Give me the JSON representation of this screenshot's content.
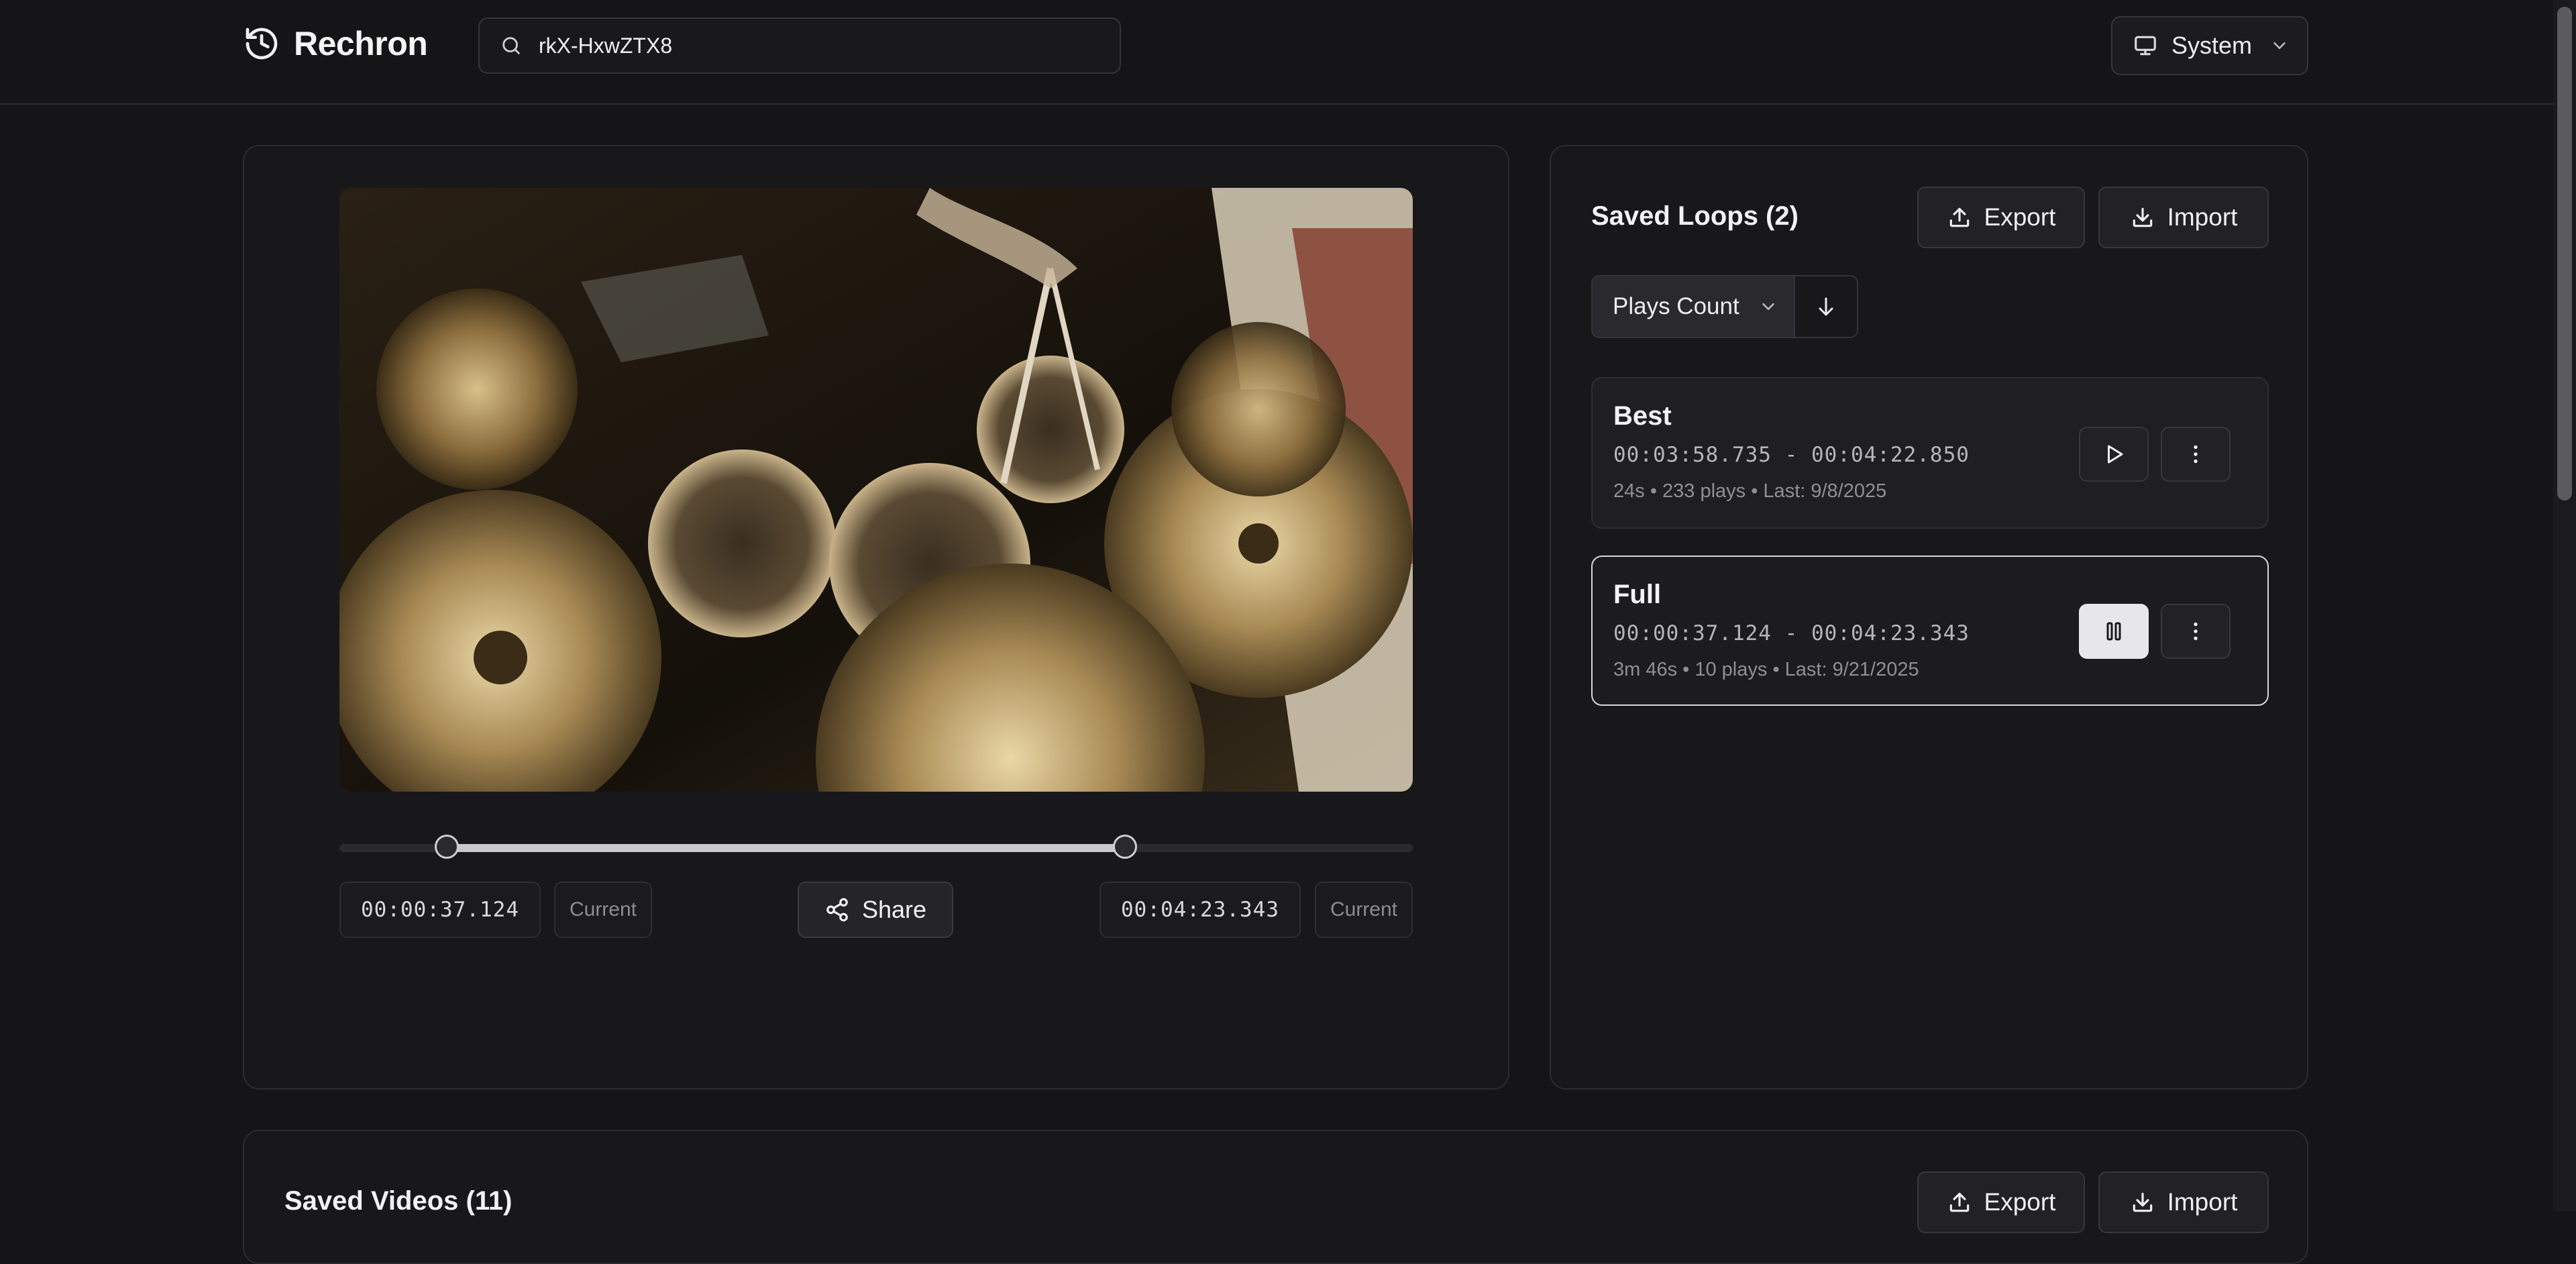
{
  "app": {
    "title": "Rechron"
  },
  "search": {
    "value": "rkX-HxwZTX8"
  },
  "theme": {
    "label": "System"
  },
  "player": {
    "start_time": "00:00:37.124",
    "end_time": "00:04:23.343",
    "current_label": "Current",
    "share_label": "Share",
    "range_fraction": {
      "start": 0.1,
      "end": 0.732
    }
  },
  "loops": {
    "title": "Saved Loops (2)",
    "export_label": "Export",
    "import_label": "Import",
    "sort": {
      "selected": "Plays Count",
      "direction": "descending"
    },
    "items": [
      {
        "name": "Best",
        "range": "00:03:58.735 - 00:04:22.850",
        "meta": "24s • 233 plays • Last: 9/8/2025",
        "state": "idle"
      },
      {
        "name": "Full",
        "range": "00:00:37.124 - 00:04:23.343",
        "meta": "3m 46s • 10 plays • Last: 9/21/2025",
        "state": "playing"
      }
    ]
  },
  "videos": {
    "title": "Saved Videos (11)",
    "export_label": "Export",
    "import_label": "Import"
  },
  "colors": {
    "background": "#151517",
    "panel": "#18181b",
    "accent_light": "#e7e7ea"
  }
}
